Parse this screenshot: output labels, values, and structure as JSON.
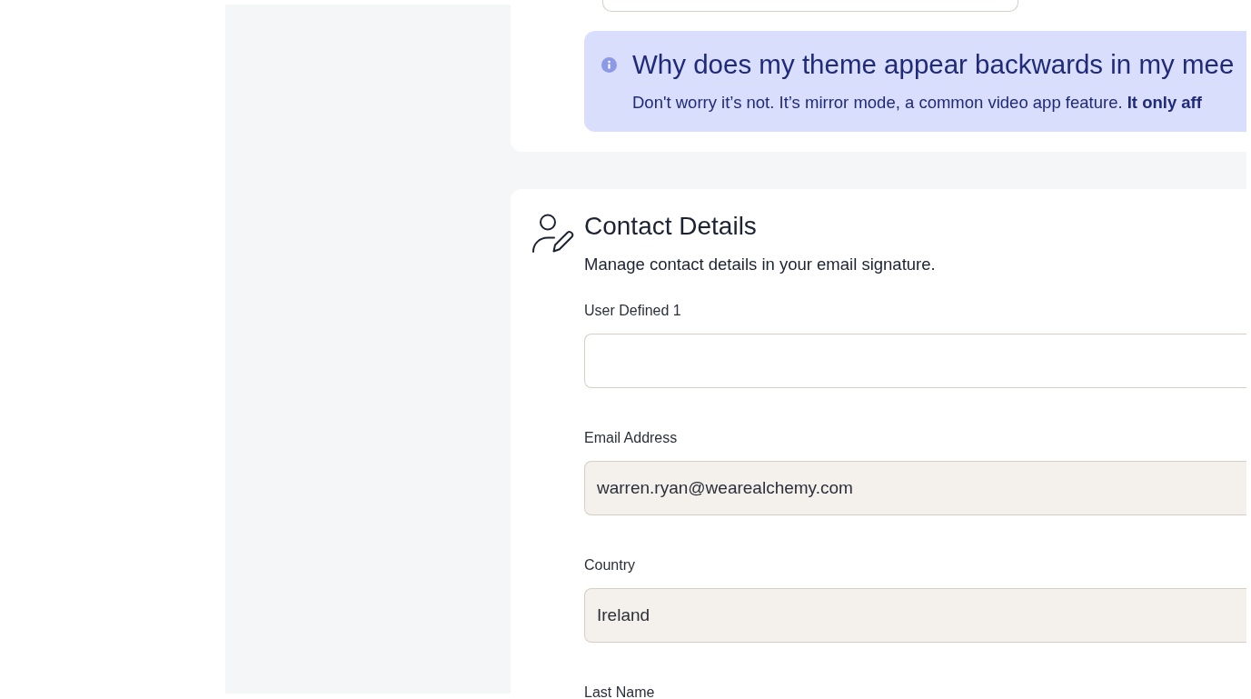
{
  "top_card": {
    "fields": [
      {
        "disabled": false
      }
    ],
    "notice": {
      "title": "Why does my theme appear backwards in my mee",
      "body": "Don't worry it’s not. It’s mirror mode, a common video app feature. **It only aff**"
    }
  },
  "contact_details": {
    "title": "Contact Details",
    "subtitle": "Manage contact details in your email signature.",
    "fields": [
      {
        "label": "User Defined 1",
        "disabled": false
      },
      {
        "label": "Email Address",
        "value": "warren.ryan@wearealchemy.com",
        "disabled": true
      },
      {
        "label": "Country",
        "value": "Ireland",
        "disabled": true
      },
      {
        "label": "Last Name"
      }
    ]
  }
}
